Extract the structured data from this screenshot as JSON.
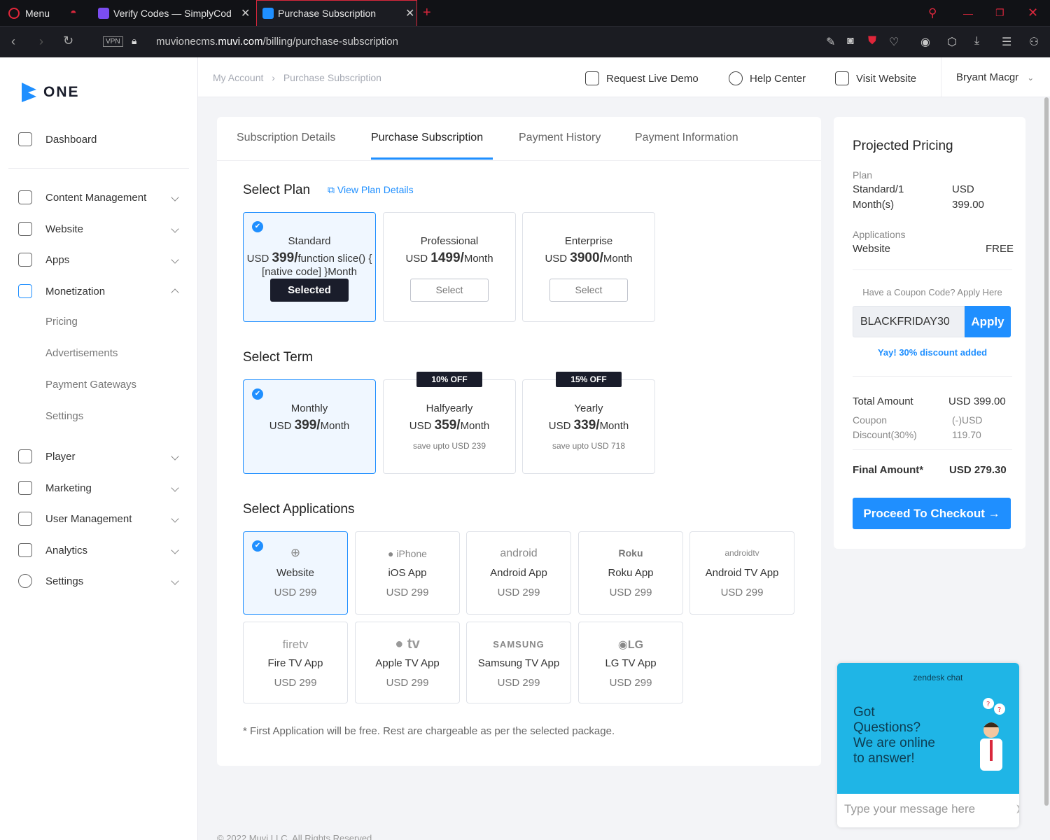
{
  "browser": {
    "menu_label": "Menu",
    "tabs": [
      {
        "label": "Verify Codes — SimplyCod"
      },
      {
        "label": "Purchase Subscription"
      }
    ],
    "vpn_label": "VPN",
    "url_prefix": "muvionecms.",
    "url_domain": "muvi.com",
    "url_path": "/billing/purchase-subscription"
  },
  "sidebar": {
    "logo_text": "ONE",
    "items": [
      {
        "label": "Dashboard",
        "icon": "home-icon"
      },
      {
        "label": "Content Management",
        "icon": "document-icon"
      },
      {
        "label": "Website",
        "icon": "monitor-icon"
      },
      {
        "label": "Apps",
        "icon": "grid-icon"
      },
      {
        "label": "Monetization",
        "icon": "wallet-icon"
      },
      {
        "label": "Player",
        "icon": "play-icon"
      },
      {
        "label": "Marketing",
        "icon": "send-icon"
      },
      {
        "label": "User Management",
        "icon": "user-icon"
      },
      {
        "label": "Analytics",
        "icon": "trend-icon"
      },
      {
        "label": "Settings",
        "icon": "gear-icon"
      }
    ],
    "monetization_sub": [
      "Pricing",
      "Advertisements",
      "Payment Gateways",
      "Settings"
    ]
  },
  "topbar": {
    "breadcrumb": [
      "My Account",
      "Purchase Subscription"
    ],
    "request_demo": "Request Live Demo",
    "help_center": "Help Center",
    "visit_website": "Visit Website",
    "user_name": "Bryant Macgr"
  },
  "tabs": [
    "Subscription Details",
    "Purchase Subscription",
    "Payment History",
    "Payment Information"
  ],
  "plan": {
    "title": "Select Plan",
    "view_details": "View Plan Details",
    "options": [
      {
        "name": "Standard",
        "currency": "USD",
        "amount": "399",
        "unit": "/Month",
        "button": "Selected"
      },
      {
        "name": "Professional",
        "currency": "USD",
        "amount": "1499",
        "unit": "/Month",
        "button": "Select"
      },
      {
        "name": "Enterprise",
        "currency": "USD",
        "amount": "3900",
        "unit": "/Month",
        "button": "Select"
      }
    ]
  },
  "term": {
    "title": "Select Term",
    "options": [
      {
        "name": "Monthly",
        "currency": "USD",
        "amount": "399",
        "unit": "/Month",
        "badge": "",
        "save": ""
      },
      {
        "name": "Halfyearly",
        "currency": "USD",
        "amount": "359",
        "unit": "/Month",
        "badge": "10% OFF",
        "save": "save upto USD 239"
      },
      {
        "name": "Yearly",
        "currency": "USD",
        "amount": "339",
        "unit": "/Month",
        "badge": "15% OFF",
        "save": "save upto USD 718"
      }
    ]
  },
  "apps": {
    "title": "Select Applications",
    "items": [
      {
        "logo": "",
        "name": "Website",
        "price": "USD 299"
      },
      {
        "logo": "iPhone",
        "name": "iOS App",
        "price": "USD 299"
      },
      {
        "logo": "android",
        "name": "Android App",
        "price": "USD 299"
      },
      {
        "logo": "Roku",
        "name": "Roku App",
        "price": "USD 299"
      },
      {
        "logo": "androidtv",
        "name": "Android TV App",
        "price": "USD 299"
      },
      {
        "logo": "firetv",
        "name": "Fire TV App",
        "price": "USD 299"
      },
      {
        "logo": "tv",
        "name": "Apple TV App",
        "price": "USD 299"
      },
      {
        "logo": "SAMSUNG",
        "name": "Samsung TV App",
        "price": "USD 299"
      },
      {
        "logo": "LG",
        "name": "LG TV App",
        "price": "USD 299"
      }
    ],
    "note": "* First Application will be free. Rest are chargeable as per the selected package."
  },
  "pricing": {
    "title": "Projected Pricing",
    "plan_label": "Plan",
    "plan_value_1": "Standard/1",
    "plan_value_2": "Month(s)",
    "plan_price_1": "USD",
    "plan_price_2": "399.00",
    "applications_label": "Applications",
    "app_name": "Website",
    "app_price": "FREE",
    "coupon_prompt": "Have a Coupon Code? Apply Here",
    "coupon_value": "BLACKFRIDAY30",
    "apply": "Apply",
    "coupon_success": "Yay! 30% discount added",
    "total_label": "Total Amount",
    "total_value": "USD 399.00",
    "discount_label_1": "Coupon",
    "discount_label_2": "Discount(30%)",
    "discount_value_1": "(-)USD",
    "discount_value_2": "119.70",
    "final_label": "Final Amount*",
    "final_value": "USD 279.30",
    "checkout": "Proceed To Checkout"
  },
  "chat": {
    "brand": "zendesk chat",
    "message_1": "Got",
    "message_2": "Questions?",
    "message_3": "We are online",
    "message_4": "to answer!",
    "placeholder": "Type your message here"
  },
  "footer": "© 2022 Muvi LLC. All Rights Reserved.",
  "colors": {
    "accent": "#1f8fff",
    "dark": "#1a1d2b",
    "chat": "#1fb5e6",
    "browser_red": "#d9273c"
  }
}
